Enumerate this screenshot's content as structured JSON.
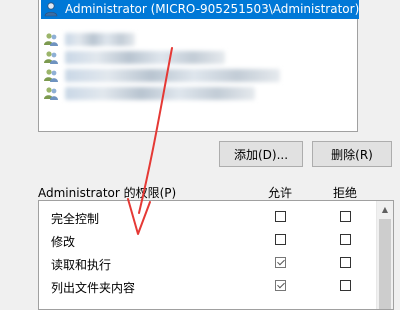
{
  "groups_list": {
    "selected_user": "Administrator (MICRO-905251503\\Administrator)"
  },
  "buttons": {
    "add_label": "添加(D)...",
    "remove_label": "删除(R)"
  },
  "permissions": {
    "header_label": "Administrator 的权限(P)",
    "allow_label": "允许",
    "deny_label": "拒绝",
    "rows": [
      {
        "label": "完全控制",
        "allow": false,
        "deny": false
      },
      {
        "label": "修改",
        "allow": false,
        "deny": false
      },
      {
        "label": "读取和执行",
        "allow": true,
        "deny": false
      },
      {
        "label": "列出文件夹内容",
        "allow": true,
        "deny": false
      }
    ]
  },
  "colors": {
    "selection": "#0078d7",
    "annotation_arrow": "#e53935"
  }
}
